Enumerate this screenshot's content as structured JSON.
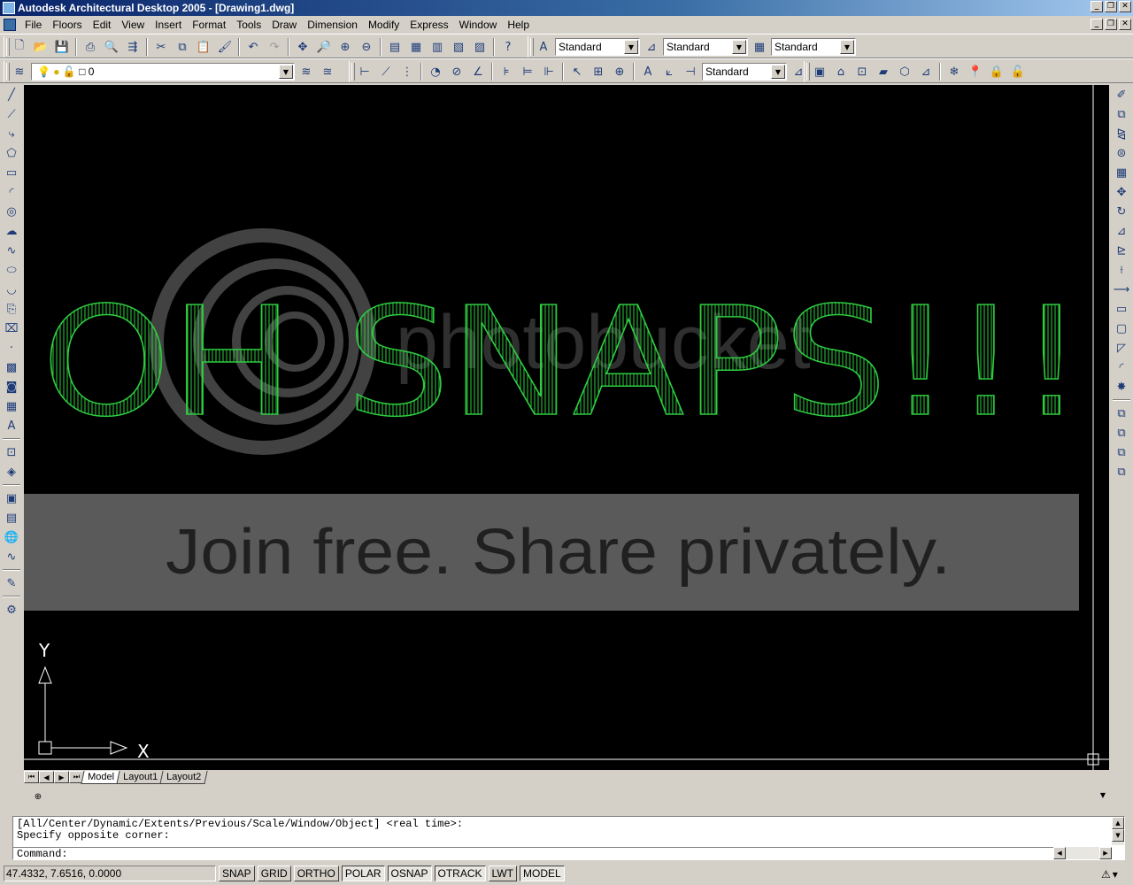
{
  "window": {
    "title": "Autodesk Architectural Desktop 2005 - [Drawing1.dwg]",
    "minimize": "_",
    "restore": "❐",
    "close": "✕"
  },
  "menu": [
    "File",
    "Floors",
    "Edit",
    "View",
    "Insert",
    "Format",
    "Tools",
    "Draw",
    "Dimension",
    "Modify",
    "Express",
    "Window",
    "Help"
  ],
  "toolbar": {
    "text_style": "Standard",
    "dim_style": "Standard",
    "table_style": "Standard",
    "layer": "0",
    "dim_style2": "Standard"
  },
  "drawing": {
    "text": "OH SNAPS!!!",
    "text_color": "#2ecc40",
    "watermark_brand": "photobucket",
    "watermark_banner": "Join free. Share privately.",
    "ucs_x": "X",
    "ucs_y": "Y"
  },
  "layout_tabs": [
    "Model",
    "Layout1",
    "Layout2"
  ],
  "command": {
    "history": [
      "[All/Center/Dynamic/Extents/Previous/Scale/Window/Object] <real time>:",
      "Specify opposite corner:"
    ],
    "prompt": "Command:"
  },
  "status": {
    "coordinates": "47.4332, 7.6516, 0.0000",
    "buttons": [
      {
        "label": "SNAP",
        "on": false
      },
      {
        "label": "GRID",
        "on": false
      },
      {
        "label": "ORTHO",
        "on": false
      },
      {
        "label": "POLAR",
        "on": true
      },
      {
        "label": "OSNAP",
        "on": true
      },
      {
        "label": "OTRACK",
        "on": true
      },
      {
        "label": "LWT",
        "on": false
      },
      {
        "label": "MODEL",
        "on": true
      }
    ]
  }
}
